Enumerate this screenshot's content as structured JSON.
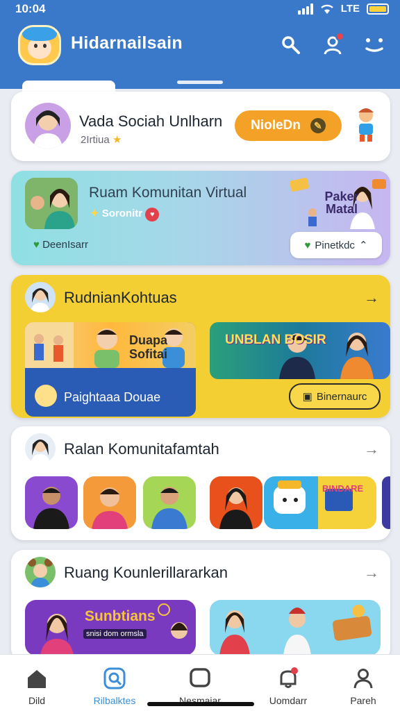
{
  "status": {
    "time": "10:04",
    "battery_label": "LTE"
  },
  "header": {
    "title": "Hidarnailsain"
  },
  "cards": {
    "profile": {
      "name": "Vada Sociah Unlharn",
      "sub": "2Irtiua",
      "action": "NioIeDn"
    },
    "community": {
      "title": "Ruam Komunitan Virtual",
      "sub": "Soronitr",
      "footer": "DeenIsarr",
      "button": "Pinetkdc",
      "art_tag": "Paker Matal"
    },
    "section1": {
      "title": "RudnianKohtuas",
      "tile_a_tag": "Duapa Sofitai",
      "tile_a_caption": "Paightaaa Douae",
      "tile_b_tag": "UNBLAN BOSIR",
      "button": "Binernaurc"
    },
    "section2": {
      "title": "Ralan Komunitafamtah"
    },
    "section3": {
      "title": "Ruang Kounlerillararkan",
      "tile_a_tag": "Sunbtians",
      "tile_a_sub": "snisi dom ormsla"
    }
  },
  "nav": {
    "items": [
      {
        "label": "Dild"
      },
      {
        "label": "Rilbalktes"
      },
      {
        "label": "Nesmaiar"
      },
      {
        "label": "Uomdarr"
      },
      {
        "label": "Pareh"
      }
    ]
  },
  "colors": {
    "header": "#3a78c9",
    "accent_orange": "#f3a127",
    "accent_yellow": "#f4cf34",
    "active_nav": "#3a8fd8"
  }
}
